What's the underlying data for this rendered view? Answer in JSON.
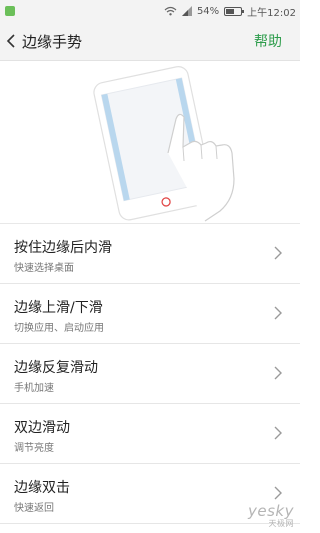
{
  "status_bar": {
    "battery_percent_label": "54%",
    "battery_level": 0.54,
    "time": "上午12:02",
    "signal_icon": "signal-icon",
    "wifi_icon": "wifi-icon"
  },
  "header": {
    "title": "边缘手势",
    "help_label": "帮助",
    "back_icon": "chevron-left-icon",
    "accent_color": "#2e9d4c"
  },
  "settings": [
    {
      "title": "按住边缘后内滑",
      "subtitle": "快速选择桌面"
    },
    {
      "title": "边缘上滑/下滑",
      "subtitle": "切换应用、启动应用"
    },
    {
      "title": "边缘反复滑动",
      "subtitle": "手机加速"
    },
    {
      "title": "双边滑动",
      "subtitle": "调节亮度"
    },
    {
      "title": "边缘双击",
      "subtitle": "快速返回"
    }
  ],
  "watermark": {
    "main": "yesky",
    "sub": "天极网"
  }
}
